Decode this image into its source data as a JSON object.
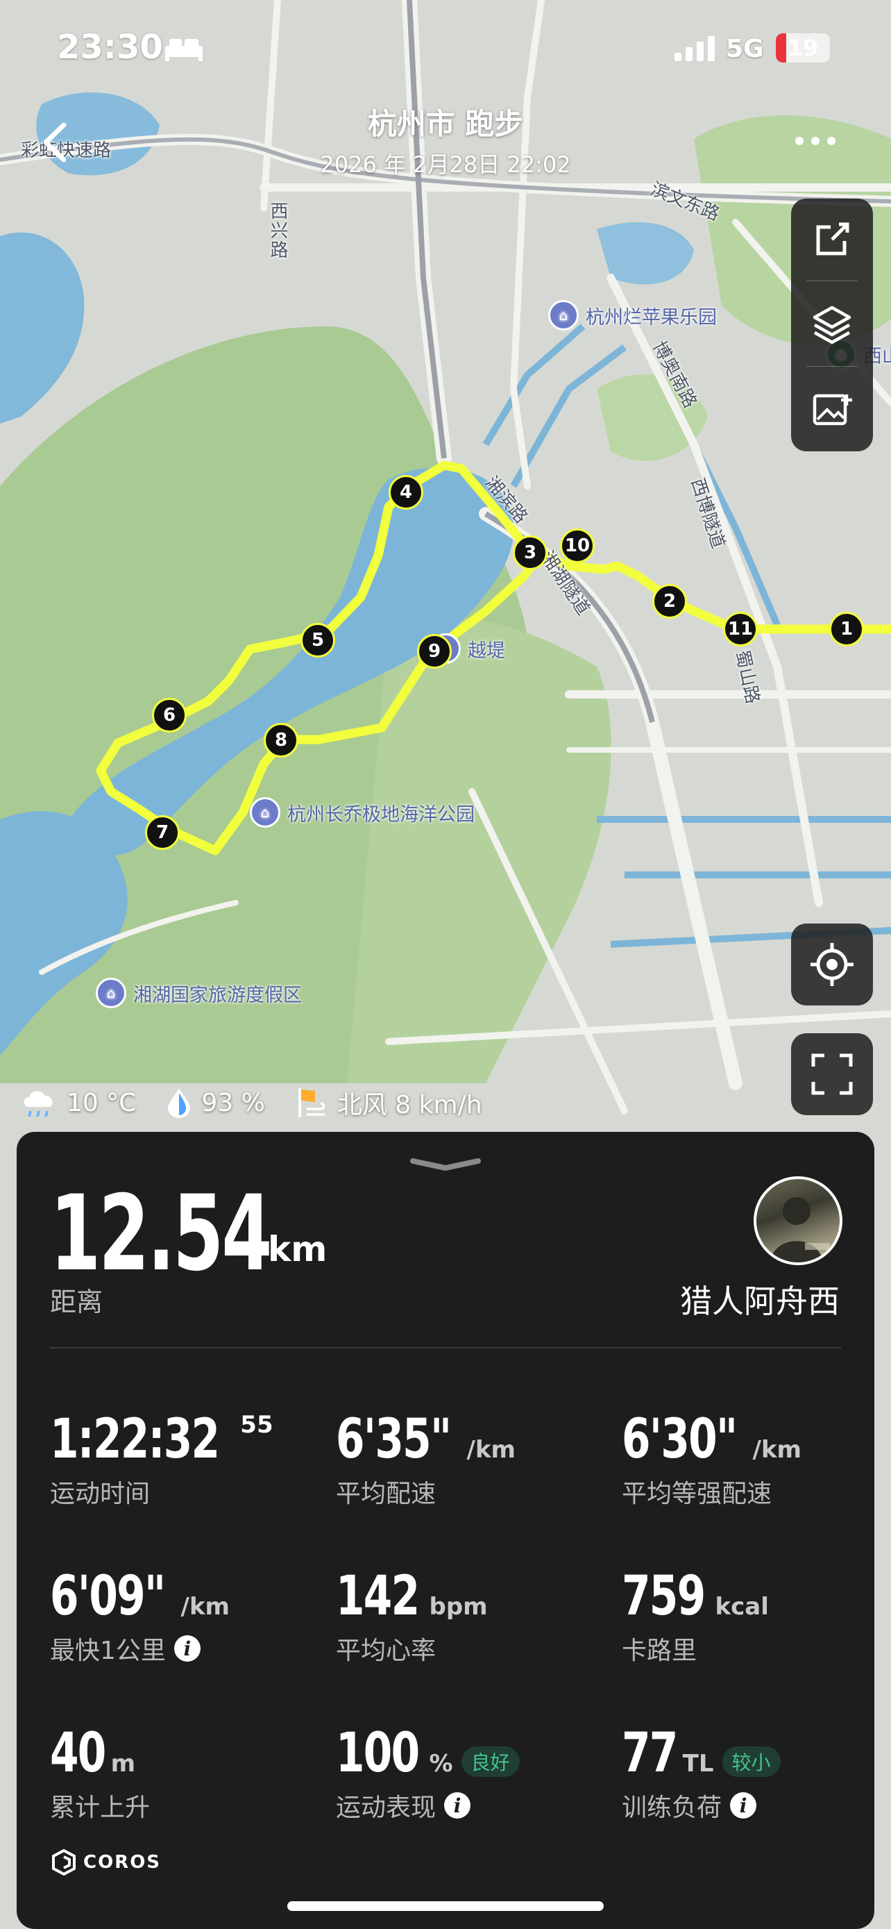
{
  "status_bar": {
    "time": "23:30",
    "network": "5G",
    "battery": "19",
    "battery_level": 0.19
  },
  "header": {
    "title": "杭州市 跑步",
    "datetime": "2026 年 2月28日 22:02"
  },
  "map": {
    "road_labels": [
      "彩虹快速路",
      "西兴路",
      "滨文东路",
      "博奥南路",
      "西博隧道",
      "湘滨路",
      "湘湖隧道",
      "蜀山路"
    ],
    "pois": [
      "杭州烂苹果乐园",
      "越堤",
      "杭州长乔极地海洋公园",
      "湘湖国家旅游度假区",
      "西山"
    ],
    "km_markers": [
      "1",
      "2",
      "3",
      "4",
      "5",
      "6",
      "7",
      "8",
      "9",
      "10",
      "11"
    ]
  },
  "weather": {
    "temperature": "10 °C",
    "humidity": "93 %",
    "wind": "北风 8 km/h"
  },
  "summary": {
    "distance_value": "12.54",
    "distance_unit": "km",
    "distance_label": "距离",
    "username": "猎人阿舟西"
  },
  "stats": {
    "duration": {
      "value": "1:22:32",
      "sup": "55",
      "label": "运动时间"
    },
    "avg_pace": {
      "value": "6'35\"",
      "unit": "/km",
      "label": "平均配速"
    },
    "avg_grade_pace": {
      "value": "6'30\"",
      "unit": "/km",
      "label": "平均等强配速"
    },
    "fastest_km": {
      "value": "6'09\"",
      "unit": "/km",
      "label": "最快1公里"
    },
    "avg_hr": {
      "value": "142",
      "unit": "bpm",
      "label": "平均心率"
    },
    "calories": {
      "value": "759",
      "unit": "kcal",
      "label": "卡路里"
    },
    "ascent": {
      "value": "40",
      "unit": "m",
      "label": "累计上升"
    },
    "performance": {
      "value": "100",
      "unit": "%",
      "badge": "良好",
      "label": "运动表现"
    },
    "training_load": {
      "value": "77",
      "unit": "TL",
      "badge": "较小",
      "label": "训练负荷"
    }
  },
  "brand": "COROS",
  "colors": {
    "route": "#f2ff3c",
    "card_bg": "#1d1d1d",
    "badge_green": "#43c48c",
    "battery_red": "#e8343a"
  }
}
